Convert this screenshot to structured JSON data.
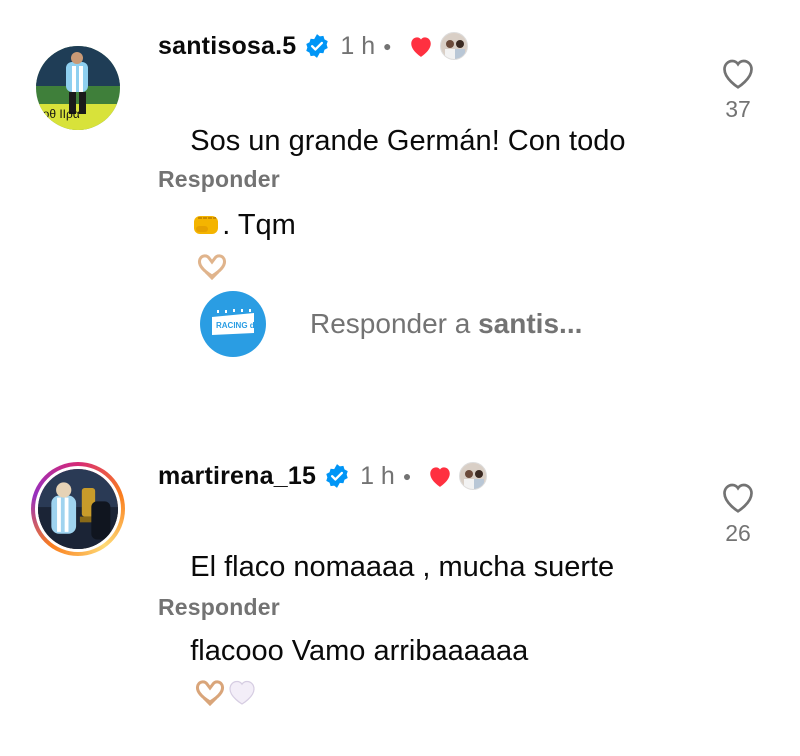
{
  "comments": [
    {
      "username": "santisosa.5",
      "time": "1 h",
      "line1": "Sos un grande Germán! Con todo",
      "line2": ". Tqm",
      "reply_label": "Responder",
      "likes": "37",
      "emoji_after_line1": "fist-emoji",
      "emoji_after_line2": "heart-hands-emoji"
    },
    {
      "username": "martirena_15",
      "time": "1 h",
      "line1": "El flaco nomaaaa , mucha suerte",
      "line2": "flacooo Vamo arribaaaaaa",
      "reply_label": "Responder",
      "likes": "26",
      "emoji_after_line2": [
        "heart-hands-emoji",
        "white-heart-emoji"
      ]
    }
  ],
  "reply_composer": {
    "prefix": "Responder a ",
    "target": "santis..."
  },
  "colors": {
    "text": "#0a0a0a",
    "muted": "#737373",
    "verified": "#0095f6",
    "heart_red": "#ff3040",
    "reply_avatar_bg": "#2a9de3"
  }
}
